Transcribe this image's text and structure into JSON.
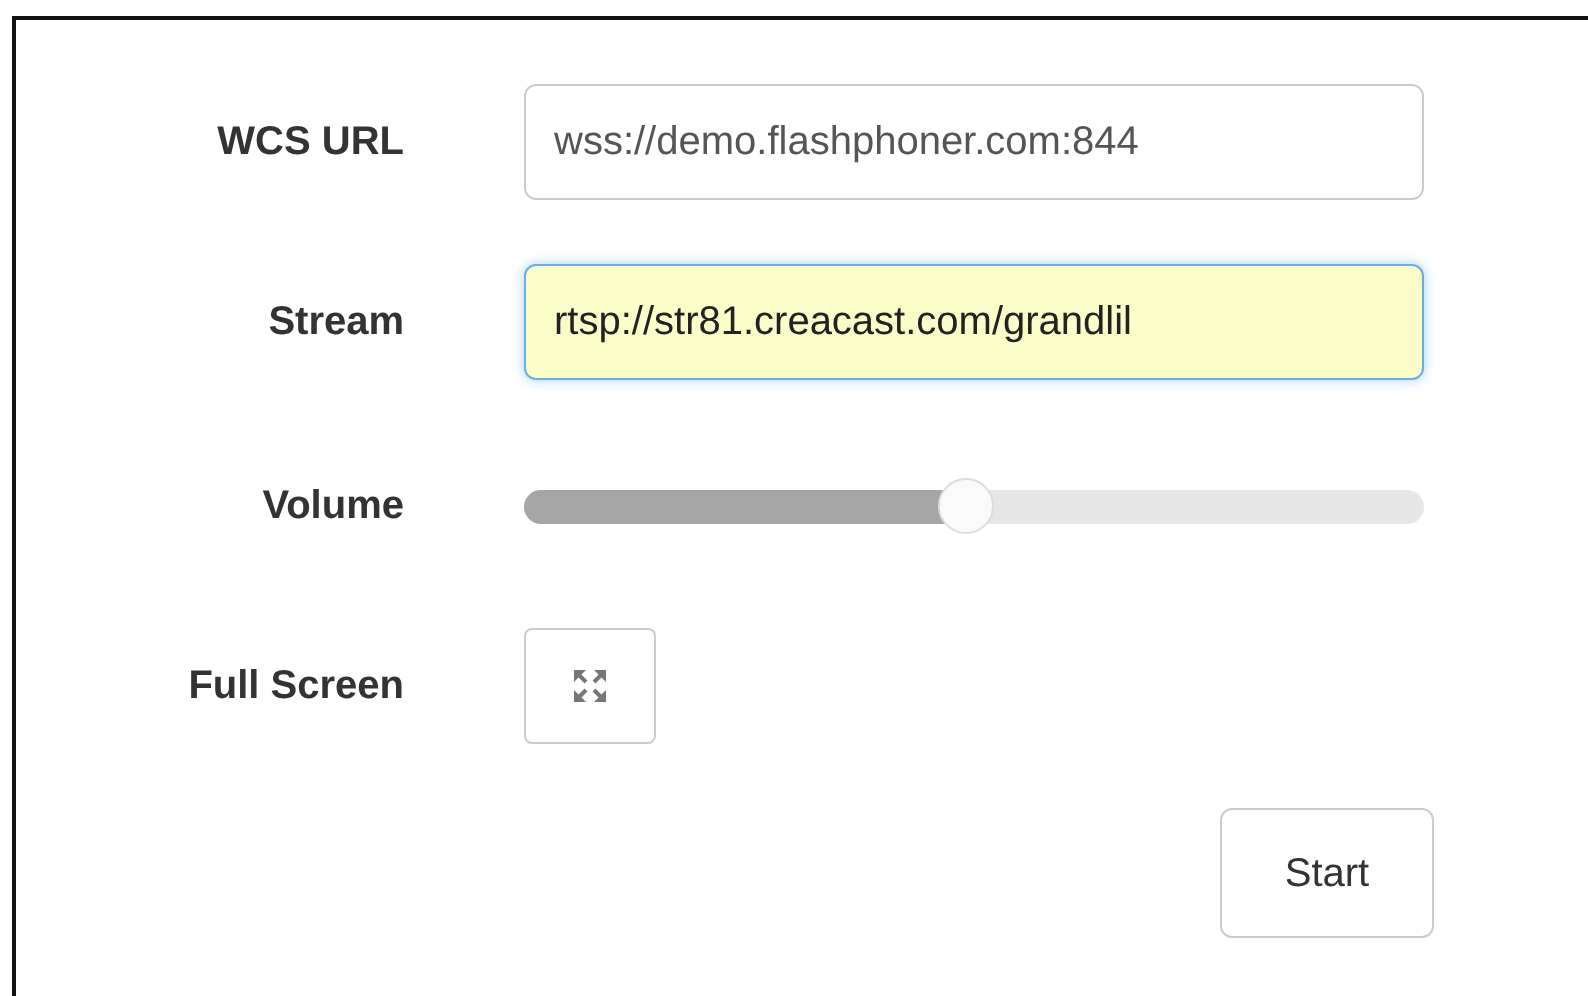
{
  "form": {
    "rows": [
      {
        "kind": "text",
        "label": "WCS URL",
        "value": "wss://demo.flashphoner.com:844",
        "highlighted": false
      },
      {
        "kind": "text",
        "label": "Stream",
        "value": "rtsp://str81.creacast.com/grandlil",
        "highlighted": true
      },
      {
        "kind": "slider",
        "label": "Volume",
        "level": 0.49
      },
      {
        "kind": "fullscreen",
        "label": "Full Screen"
      }
    ]
  },
  "buttons": [
    "Start"
  ]
}
